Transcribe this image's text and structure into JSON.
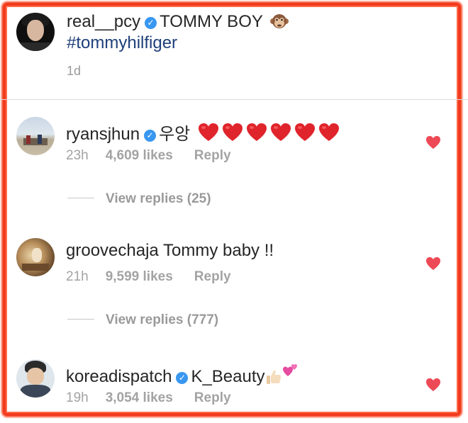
{
  "post": {
    "username": "real__pcy",
    "verified": true,
    "caption": "TOMMY BOY",
    "caption_emoji": "monkey-face",
    "hashtag": "#tommyhilfiger",
    "time": "1d"
  },
  "comments": [
    {
      "username": "ryansjhun",
      "verified": true,
      "text": "우앙",
      "emoji": "red-heart x6",
      "time": "23h",
      "likes": "4,609 likes",
      "reply": "Reply",
      "view_replies": "View replies (25)"
    },
    {
      "username": "groovechaja",
      "verified": false,
      "text": "Tommy baby !!",
      "time": "21h",
      "likes": "9,599 likes",
      "reply": "Reply",
      "view_replies": "View replies (777)"
    },
    {
      "username": "koreadispatch",
      "verified": true,
      "text": "K_Beauty",
      "emoji": "thumbs-up, two-hearts",
      "time": "19h",
      "likes": "3,054 likes",
      "reply": "Reply"
    }
  ],
  "colors": {
    "frame": "#f23a1d",
    "verified": "#3897f0",
    "like_heart": "#ed4956",
    "hashtag": "#1e3f7a"
  }
}
